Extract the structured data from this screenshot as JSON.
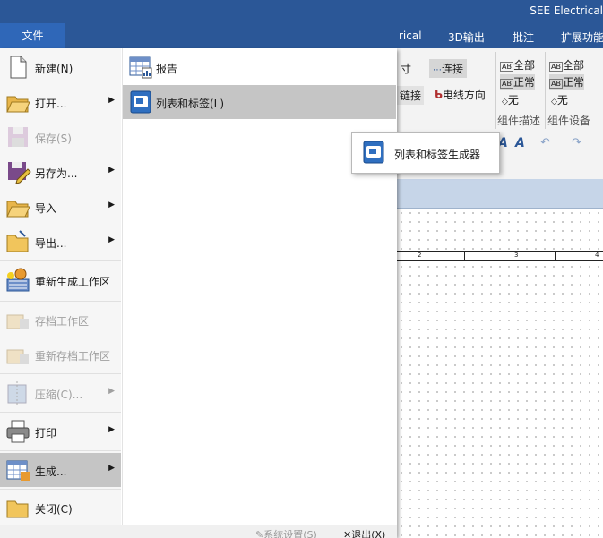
{
  "window": {
    "title": "SEE Electrical"
  },
  "file_tab": {
    "label": "文件"
  },
  "tabs": [
    "rical",
    "3D输出",
    "批注",
    "扩展功能"
  ],
  "ribbon": {
    "size_partial": "寸",
    "connect": "连接",
    "link": "链接",
    "wire_direction": "电线方向",
    "comp_desc": {
      "all": "全部",
      "normal": "正常",
      "none": "无",
      "group_label": "组件描述"
    },
    "comp_device": {
      "all": "全部",
      "normal": "正常",
      "none": "无",
      "group_label": "组件设备"
    }
  },
  "ruler": {
    "labels": [
      "2",
      "3",
      "4"
    ]
  },
  "menu": {
    "items": [
      {
        "label": "新建(N)",
        "icon": "new-doc-icon",
        "arrow": false,
        "disabled": false
      },
      {
        "label": "打开...",
        "icon": "open-folder-icon",
        "arrow": true,
        "disabled": false
      },
      {
        "label": "保存(S)",
        "icon": "save-icon",
        "arrow": false,
        "disabled": true
      },
      {
        "label": "另存为...",
        "icon": "save-as-icon",
        "arrow": true,
        "disabled": false
      },
      {
        "label": "导入",
        "icon": "import-folder-icon",
        "arrow": true,
        "disabled": false
      },
      {
        "label": "导出...",
        "icon": "export-folder-icon",
        "arrow": true,
        "disabled": false
      },
      {
        "label": "重新生成工作区",
        "icon": "regenerate-workspace-icon",
        "arrow": false,
        "disabled": false
      },
      {
        "label": "存档工作区",
        "icon": "archive-workspace-icon",
        "arrow": false,
        "disabled": true
      },
      {
        "label": "重新存档工作区",
        "icon": "rearchive-workspace-icon",
        "arrow": false,
        "disabled": true
      },
      {
        "label": "压缩(C)...",
        "icon": "compress-icon",
        "arrow": true,
        "disabled": true
      },
      {
        "label": "打印",
        "icon": "printer-icon",
        "arrow": true,
        "disabled": false
      },
      {
        "label": "生成...",
        "icon": "generate-table-icon",
        "arrow": true,
        "disabled": false,
        "highlighted": true
      },
      {
        "label": "关闭(C)",
        "icon": "close-folder-icon",
        "arrow": false,
        "disabled": false
      }
    ],
    "submenu": [
      {
        "label": "报告",
        "icon": "report-icon"
      },
      {
        "label": "列表和标签(L)",
        "icon": "list-label-icon",
        "highlighted": true
      }
    ],
    "flyout": {
      "label": "列表和标签生成器",
      "icon": "list-label-generator-icon"
    },
    "bottom": {
      "settings": "系统设置(S)",
      "exit": "退出(X)"
    }
  },
  "colors": {
    "titlebar": "#2b5797",
    "file_tab": "#2f67b8",
    "menu_highlight": "#c5c5c5",
    "grid_bar": "#c6d5e8"
  }
}
